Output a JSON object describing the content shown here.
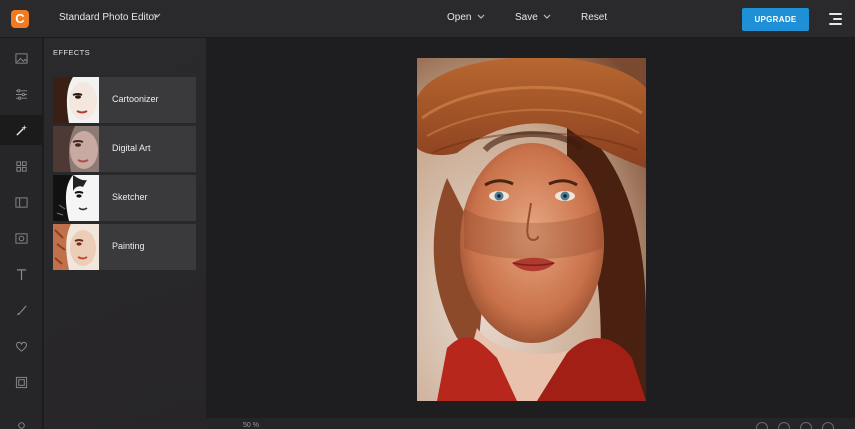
{
  "header": {
    "logo_glyph": "C",
    "app_title": "Standard Photo Editor",
    "menu": {
      "open": "Open",
      "save": "Save",
      "reset": "Reset"
    },
    "upgrade_label": "UPGRADE"
  },
  "tools": [
    "image-icon",
    "adjust-icon",
    "effects-wand-icon",
    "grid-icon",
    "layout-icon",
    "camera-frame-icon",
    "text-icon",
    "brush-icon",
    "heart-icon",
    "frame-icon",
    "more-icon"
  ],
  "panel": {
    "title": "EFFECTS",
    "effects": [
      {
        "label": "Cartoonizer"
      },
      {
        "label": "Digital Art"
      },
      {
        "label": "Sketcher"
      },
      {
        "label": "Painting"
      }
    ]
  },
  "footer": {
    "zoom": "50 %"
  },
  "colors": {
    "accent": "#1f8fd6",
    "brand": "#f47a1f",
    "background": "#1f1f21"
  }
}
